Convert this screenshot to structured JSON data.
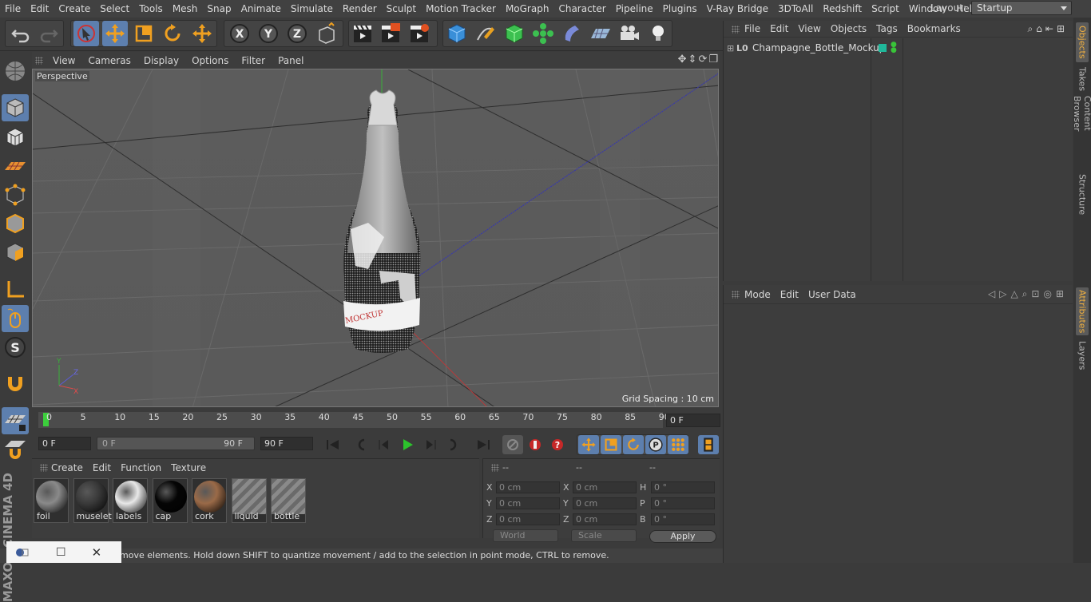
{
  "menubar": {
    "items": [
      "File",
      "Edit",
      "Create",
      "Select",
      "Tools",
      "Mesh",
      "Snap",
      "Animate",
      "Simulate",
      "Render",
      "Sculpt",
      "Motion Tracker",
      "MoGraph",
      "Character",
      "Pipeline",
      "Plugins",
      "V-Ray Bridge",
      "3DToAll",
      "Redshift",
      "Script",
      "Window",
      "Help"
    ],
    "layout_label": "Layout:",
    "layout_value": "Startup"
  },
  "viewport": {
    "menu": [
      "View",
      "Cameras",
      "Display",
      "Options",
      "Filter",
      "Panel"
    ],
    "label": "Perspective",
    "grid_spacing": "Grid Spacing : 10 cm"
  },
  "timeline": {
    "ticks": [
      "0",
      "5",
      "10",
      "15",
      "20",
      "25",
      "30",
      "35",
      "40",
      "45",
      "50",
      "55",
      "60",
      "65",
      "70",
      "75",
      "80",
      "85",
      "90"
    ],
    "current_frame": "0 F",
    "start_field": "0 F",
    "range_start": "0 F",
    "range_end": "90 F",
    "end_field": "90 F"
  },
  "materials": {
    "menu": [
      "Create",
      "Edit",
      "Function",
      "Texture"
    ],
    "items": [
      {
        "name": "foil",
        "color": "#8a8a8a"
      },
      {
        "name": "muselet",
        "color": "#3a3a3a"
      },
      {
        "name": "labels",
        "color": "#e8e8e8"
      },
      {
        "name": "cap",
        "color": "#050505"
      },
      {
        "name": "cork",
        "color": "#9a6a48"
      },
      {
        "name": "liquid",
        "color": "striped"
      },
      {
        "name": "bottle",
        "color": "striped"
      }
    ]
  },
  "coords": {
    "headers": [
      "--",
      "--",
      "--"
    ],
    "rows": [
      {
        "a": "X",
        "av": "0 cm",
        "b": "X",
        "bv": "0 cm",
        "c": "H",
        "cv": "0 °"
      },
      {
        "a": "Y",
        "av": "0 cm",
        "b": "Y",
        "bv": "0 cm",
        "c": "P",
        "cv": "0 °"
      },
      {
        "a": "Z",
        "av": "0 cm",
        "b": "Z",
        "bv": "0 cm",
        "c": "B",
        "cv": "0 °"
      }
    ],
    "mode_world": "World",
    "mode_scale": "Scale",
    "apply": "Apply"
  },
  "objects": {
    "menu": [
      "File",
      "Edit",
      "View",
      "Objects",
      "Tags",
      "Bookmarks"
    ],
    "items": [
      {
        "name": "Champagne_Bottle_Mockup"
      }
    ]
  },
  "attributes": {
    "menu": [
      "Mode",
      "Edit",
      "User Data"
    ]
  },
  "sidetabs": [
    "Objects",
    "Takes",
    "Content Browser",
    "Structure",
    "Attributes",
    "Layers"
  ],
  "status": "move elements. Hold down SHIFT to quantize movement / add to the selection in point mode, CTRL to remove.",
  "brand": "MAXON CINEMA 4D",
  "colors": {
    "accent": "#5d7fae",
    "tag_teal": "#1fb89a",
    "tag_green": "#39c439"
  }
}
